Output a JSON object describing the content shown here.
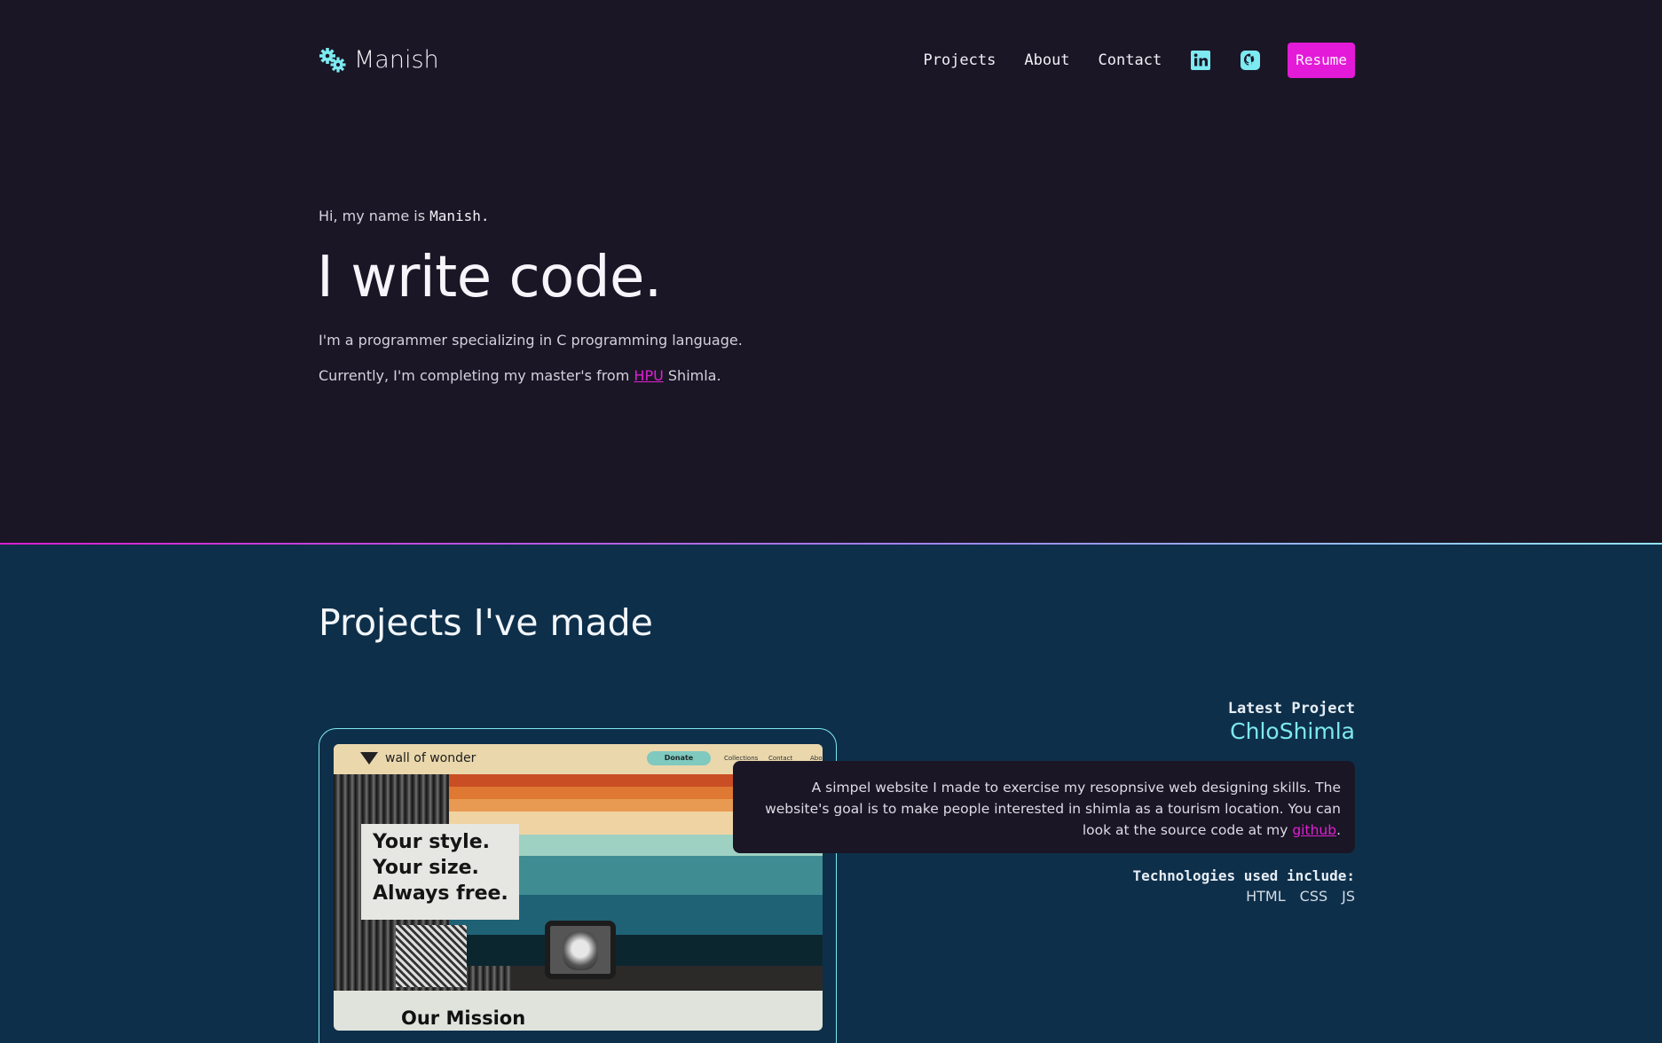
{
  "header": {
    "logo_text": "Manish",
    "logo_icon": "gears-icon",
    "nav": [
      {
        "label": "Projects"
      },
      {
        "label": "About"
      },
      {
        "label": "Contact"
      }
    ],
    "icons": [
      "linkedin-icon",
      "github-icon"
    ],
    "resume_label": "Resume"
  },
  "hero": {
    "greeting_prefix": "Hi, my name is",
    "greeting_name": "Manish.",
    "headline": "I write code.",
    "line1": "I'm a programmer specializing in C programming language.",
    "line2_prefix": "Currently, I'm completing my master's from",
    "line2_link": "HPU",
    "line2_suffix": "Shimla."
  },
  "projects": {
    "title": "Projects I've made",
    "latest_label": "Latest Project",
    "name": "ChloShimla",
    "description": "A simpel website I made to exercise my resopnsive web designing skills. The website's goal is to make people interested in shimla as a tourism location. You can look at the source code at my",
    "description_link": "github",
    "description_end": ".",
    "tech_label": "Technologies used include:",
    "tech": [
      "HTML",
      "CSS",
      "JS"
    ],
    "screenshot": {
      "site_name": "wall of wonder",
      "donate": "Donate",
      "nav": [
        "Collections",
        "Contact",
        "Abo"
      ],
      "hero_text": "Your style.\nYour size.\nAlways free.",
      "section": "Our Mission"
    }
  },
  "colors": {
    "accent_pink": "#e31ad8",
    "accent_cyan": "#7de9f0",
    "top_bg": "#1a1625",
    "bottom_bg": "#0e2f4a"
  }
}
